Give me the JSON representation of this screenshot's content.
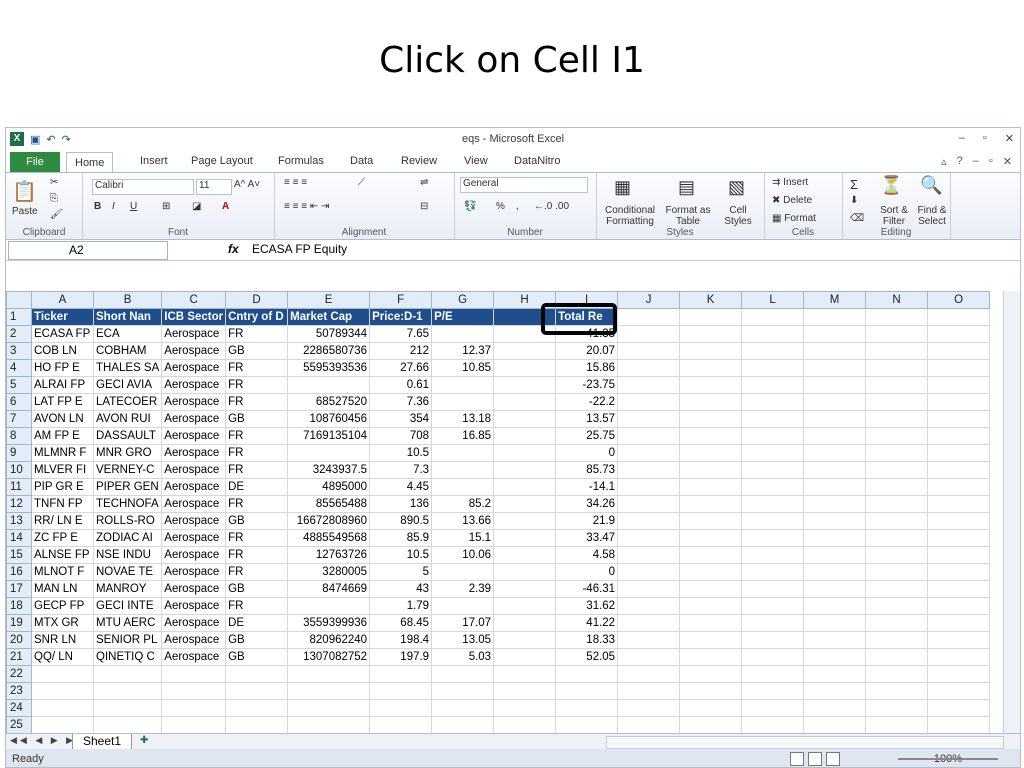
{
  "slide": {
    "title": "Click on Cell I1"
  },
  "window": {
    "title": "eqs - Microsoft Excel",
    "quick_access": [
      "save-icon",
      "undo-icon",
      "redo-icon"
    ],
    "buttons": [
      "minimize-icon",
      "restore-icon",
      "close-icon"
    ]
  },
  "ribbon_tabs": {
    "file": "File",
    "tabs": [
      "Home",
      "Insert",
      "Page Layout",
      "Formulas",
      "Data",
      "Review",
      "View",
      "DataNitro"
    ]
  },
  "ribbon": {
    "clipboard": {
      "paste": "Paste",
      "label": "Clipboard"
    },
    "font": {
      "name": "Calibri",
      "size": "11",
      "label": "Font",
      "bold": "B",
      "italic": "I",
      "underline": "U"
    },
    "alignment": {
      "label": "Alignment"
    },
    "number": {
      "format": "General",
      "percent": "%",
      "comma": ",",
      "inc_decimal": "←.0 .00",
      "dec_decimal": ".00 →.0",
      "label": "Number"
    },
    "styles": {
      "conditional": "Conditional Formatting",
      "format_table": "Format as Table",
      "cell_styles": "Cell Styles",
      "label": "Styles"
    },
    "cells": {
      "insert": "Insert",
      "delete": "Delete",
      "format": "Format",
      "label": "Cells"
    },
    "editing": {
      "sort": "Sort & Filter",
      "find": "Find & Select",
      "sum": "Σ",
      "label": "Editing"
    }
  },
  "formula_bar": {
    "name_box": "A2",
    "fx": "fx",
    "value": "ECASA  FP Equity"
  },
  "columns": [
    "A",
    "B",
    "C",
    "D",
    "E",
    "F",
    "G",
    "H",
    "I",
    "J",
    "K",
    "L",
    "M",
    "N",
    "O"
  ],
  "header_row": [
    "Ticker",
    "Short Nan",
    "ICB Sector",
    "Cntry of D",
    "Market Cap",
    "Price:D-1",
    "P/E",
    "",
    "Total Re"
  ],
  "rows": [
    [
      "ECASA  FP",
      "ECA",
      "Aerospace",
      "FR",
      "50789344",
      "7.65",
      "",
      "",
      "-41.35"
    ],
    [
      "COB    LN",
      "COBHAM",
      "Aerospace",
      "GB",
      "2286580736",
      "212",
      "12.37",
      "",
      "20.07"
    ],
    [
      "HO    FP E",
      "THALES SA",
      "Aerospace",
      "FR",
      "5595393536",
      "27.66",
      "10.85",
      "",
      "15.86"
    ],
    [
      "ALRAI  FP",
      "GECI AVIA",
      "Aerospace",
      "FR",
      "",
      "0.61",
      "",
      "",
      "-23.75"
    ],
    [
      "LAT    FP E",
      "LATECOER",
      "Aerospace",
      "FR",
      "68527520",
      "7.36",
      "",
      "",
      "-22.2"
    ],
    [
      "AVON   LN",
      "AVON RUI",
      "Aerospace",
      "GB",
      "108760456",
      "354",
      "13.18",
      "",
      "13.57"
    ],
    [
      "AM     FP E",
      "DASSAULT",
      "Aerospace",
      "FR",
      "7169135104",
      "708",
      "16.85",
      "",
      "25.75"
    ],
    [
      "MLMNR  F",
      "MNR GRO",
      "Aerospace",
      "FR",
      "",
      "10.5",
      "",
      "",
      "0"
    ],
    [
      "MLVER  FI",
      "VERNEY-C",
      "Aerospace",
      "FR",
      "3243937.5",
      "7.3",
      "",
      "",
      "85.73"
    ],
    [
      "PIP    GR E",
      "PIPER GEN",
      "Aerospace",
      "DE",
      "4895000",
      "4.45",
      "",
      "",
      "-14.1"
    ],
    [
      "TNFN   FP",
      "TECHNOFA",
      "Aerospace",
      "FR",
      "85565488",
      "136",
      "85.2",
      "",
      "34.26"
    ],
    [
      "RR/    LN E",
      "ROLLS-RO",
      "Aerospace",
      "GB",
      "16672808960",
      "890.5",
      "13.66",
      "",
      "21.9"
    ],
    [
      "ZC     FP E",
      "ZODIAC AI",
      "Aerospace",
      "FR",
      "4885549568",
      "85.9",
      "15.1",
      "",
      "33.47"
    ],
    [
      "ALNSE  FP",
      "NSE INDU",
      "Aerospace",
      "FR",
      "12763726",
      "10.5",
      "10.06",
      "",
      "4.58"
    ],
    [
      "MLNOT  F",
      "NOVAE TE",
      "Aerospace",
      "FR",
      "3280005",
      "5",
      "",
      "",
      "0"
    ],
    [
      "MAN    LN",
      "MANROY",
      "Aerospace",
      "GB",
      "8474669",
      "43",
      "2.39",
      "",
      "-46.31"
    ],
    [
      "GECP   FP",
      "GECI INTE",
      "Aerospace",
      "FR",
      "",
      "1.79",
      "",
      "",
      "31.62"
    ],
    [
      "MTX    GR",
      "MTU AERC",
      "Aerospace",
      "DE",
      "3559399936",
      "68.45",
      "17.07",
      "",
      "41.22"
    ],
    [
      "SNR    LN",
      "SENIOR PL",
      "Aerospace",
      "GB",
      "820962240",
      "198.4",
      "13.05",
      "",
      "18.33"
    ],
    [
      "QQ/    LN",
      "QINETIQ C",
      "Aerospace",
      "GB",
      "1307082752",
      "197.9",
      "5.03",
      "",
      "52.05"
    ]
  ],
  "sheet_tab": "Sheet1",
  "status": {
    "ready": "Ready",
    "zoom": "100%"
  }
}
